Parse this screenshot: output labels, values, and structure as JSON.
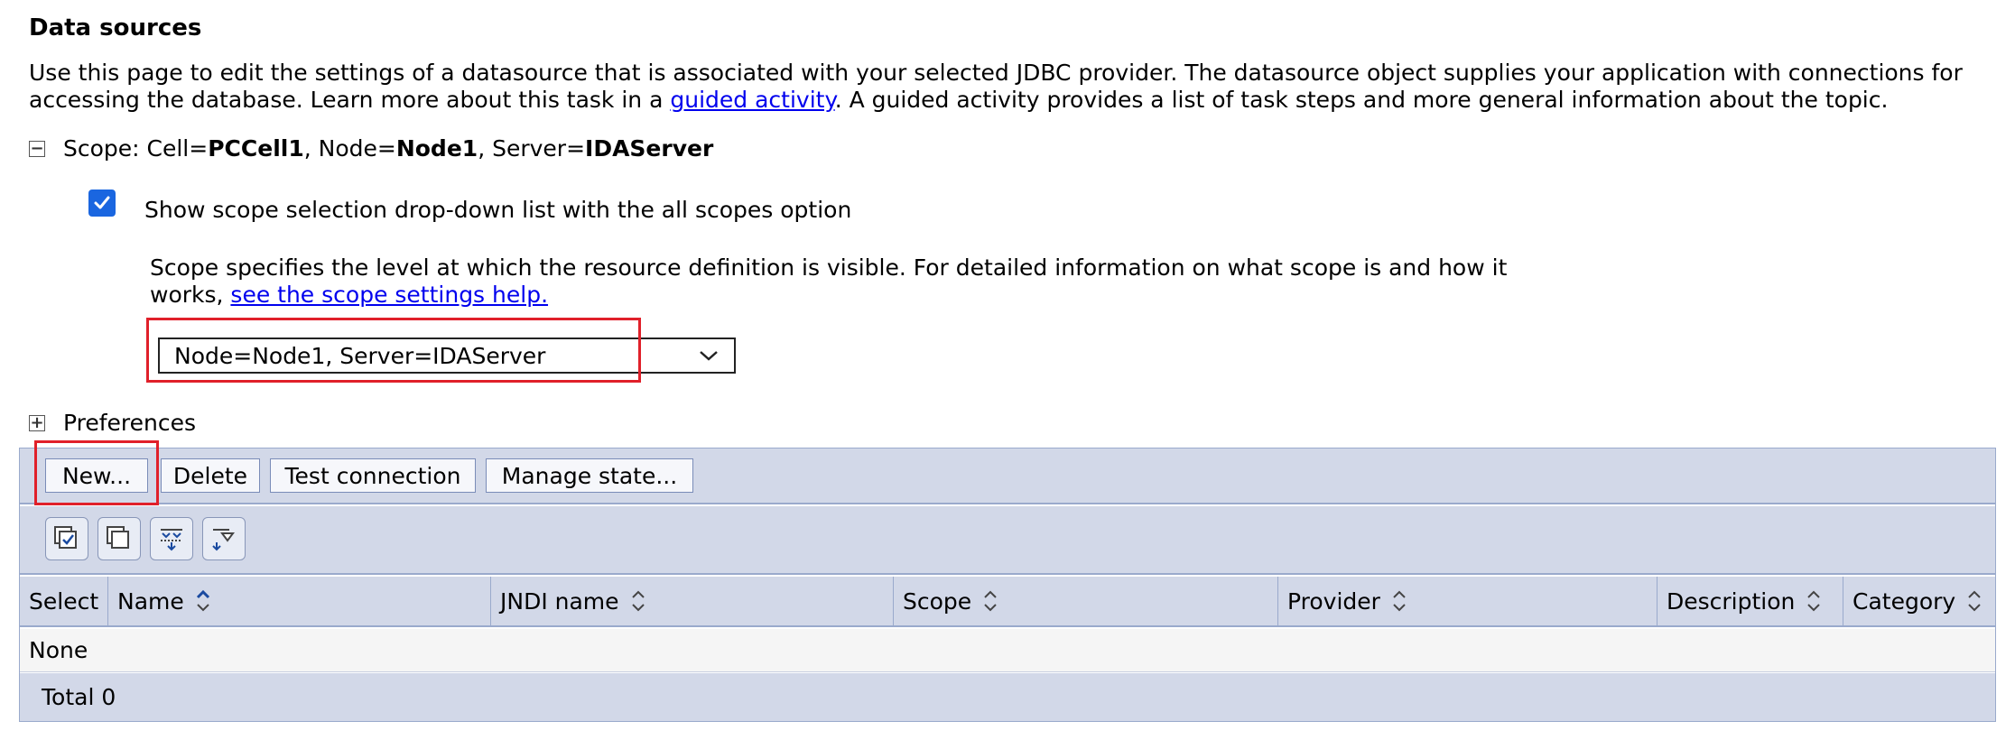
{
  "page": {
    "title": "Data sources",
    "description_part1": "Use this page to edit the settings of a datasource that is associated with your selected JDBC provider. The datasource object supplies your application with connections for accessing the database. Learn more about this task in a ",
    "description_link": "guided activity",
    "description_part2": ". A guided activity provides a list of task steps and more general information about the topic."
  },
  "scope": {
    "prefix": "Scope: Cell=",
    "cell": "PCCell1",
    "node_label": ", Node=",
    "node": "Node1",
    "server_label": ", Server=",
    "server": "IDAServer",
    "checkbox_label": "Show scope selection drop-down list with the all scopes option",
    "checkbox_checked": true,
    "help_text": "Scope specifies the level at which the resource definition is visible. For detailed information on what scope is and how it works, ",
    "help_link": "see the scope settings help.",
    "selected_value": "Node=Node1, Server=IDAServer"
  },
  "preferences": {
    "label": "Preferences"
  },
  "toolbar": {
    "new_label": "New...",
    "delete_label": "Delete",
    "test_label": "Test connection",
    "manage_label": "Manage state..."
  },
  "table": {
    "columns": [
      "Select",
      "Name",
      "JNDI name",
      "Scope",
      "Provider",
      "Description",
      "Category"
    ],
    "empty_text": "None",
    "total_text": "Total 0"
  },
  "colors": {
    "highlight": "#e0202a",
    "toolbar_bg": "#d2d8e8",
    "checkbox": "#1a66e0",
    "link": "#0000ee"
  }
}
